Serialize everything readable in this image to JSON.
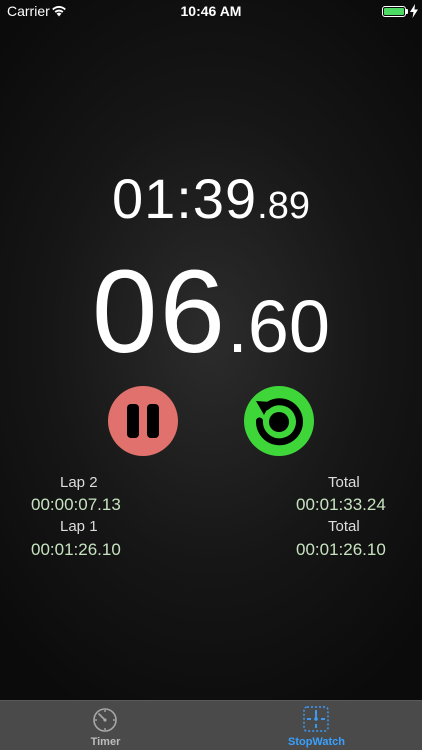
{
  "status_bar": {
    "carrier": "Carrier",
    "time": "10:46 AM"
  },
  "total": {
    "main": "01:39",
    "fraction": ".89"
  },
  "lap": {
    "main": "06",
    "fraction": ".60"
  },
  "controls": {
    "pause_icon": "pause-icon",
    "reset_icon": "reset-icon",
    "pause_color": "#e0716c",
    "reset_color": "#3fd63a"
  },
  "laps": [
    {
      "lap_label": "Lap 2",
      "lap_time": "00:00:07.13",
      "total_label": "Total",
      "total_time": "00:01:33.24"
    },
    {
      "lap_label": "Lap 1",
      "lap_time": "00:01:26.10",
      "total_label": "Total",
      "total_time": "00:01:26.10"
    }
  ],
  "tabs": [
    {
      "label": "Timer",
      "icon": "timer-icon",
      "active": false
    },
    {
      "label": "StopWatch",
      "icon": "stopwatch-icon",
      "active": true
    }
  ],
  "colors": {
    "accent": "#3aa0ff",
    "lap_text": "#c6e3c0"
  }
}
